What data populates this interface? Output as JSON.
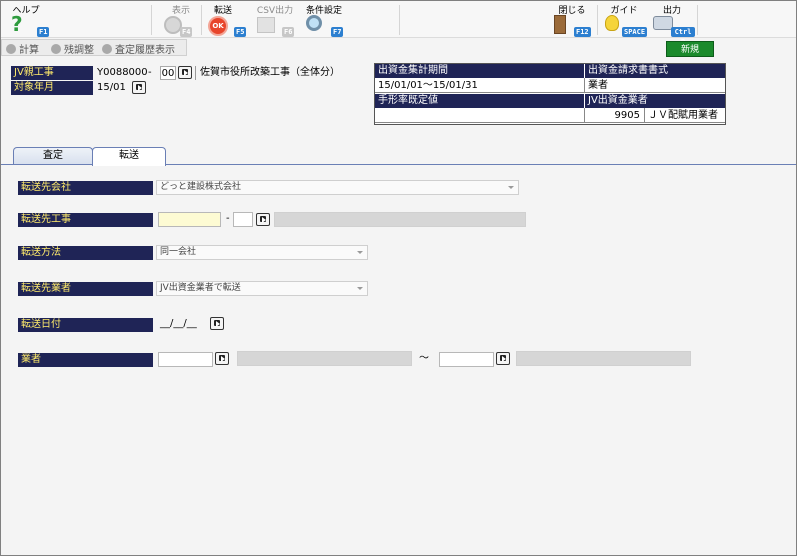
{
  "toolbar": {
    "help": {
      "label": "ヘルプ",
      "key": "F1"
    },
    "display": {
      "label": "表示",
      "key": "F4"
    },
    "transfer": {
      "label": "転送",
      "key": "F5",
      "icon_text": "OK"
    },
    "csv": {
      "label": "CSV出力",
      "key": "F6"
    },
    "conditions": {
      "label": "条件設定",
      "key": "F7"
    },
    "close": {
      "label": "閉じる",
      "key": "F12"
    },
    "guide": {
      "label": "ガイド",
      "key": "SPACE"
    },
    "output": {
      "label": "出力",
      "key": "Ctrl P"
    }
  },
  "subbar": {
    "calc": "計算",
    "balance": "残調整",
    "history": "査定履歴表示"
  },
  "new_button": "新規",
  "header": {
    "jv_project_label": "JV親工事",
    "jv_project_code": "Y0088000",
    "jv_project_dash": "-",
    "jv_project_branch": "00",
    "jv_project_name": "佐賀市役所改築工事（全体分）",
    "target_month_label": "対象年月",
    "target_month_value": "15/01"
  },
  "info": {
    "period_label": "出資金集計期間",
    "period_value": "15/01/01～15/01/31",
    "format_label": "出資金請求書書式",
    "format_value": "業者",
    "note_label": "手形率既定値",
    "note_value": "",
    "vendor_label": "JV出資金業者",
    "vendor_code": "9905",
    "vendor_name": "ＪＶ配賦用業者"
  },
  "tabs": [
    "査定",
    "転送"
  ],
  "form": {
    "dest_company_label": "転送先会社",
    "dest_company_value": "どっと建設株式会社",
    "dest_project_label": "転送先工事",
    "dest_project_dash": "-",
    "method_label": "転送方法",
    "method_value": "同一会社",
    "dest_vendor_label": "転送先業者",
    "dest_vendor_value": "JV出資金業者で転送",
    "date_label": "転送日付",
    "date_value": "__/__/__",
    "vendor_label": "業者",
    "range_sep": "～"
  },
  "colors": {
    "label_bg": "#1f2456",
    "label_text": "#ffeb6b",
    "accent_key": "#2c7fd0",
    "new_button": "#1b8a2c"
  }
}
